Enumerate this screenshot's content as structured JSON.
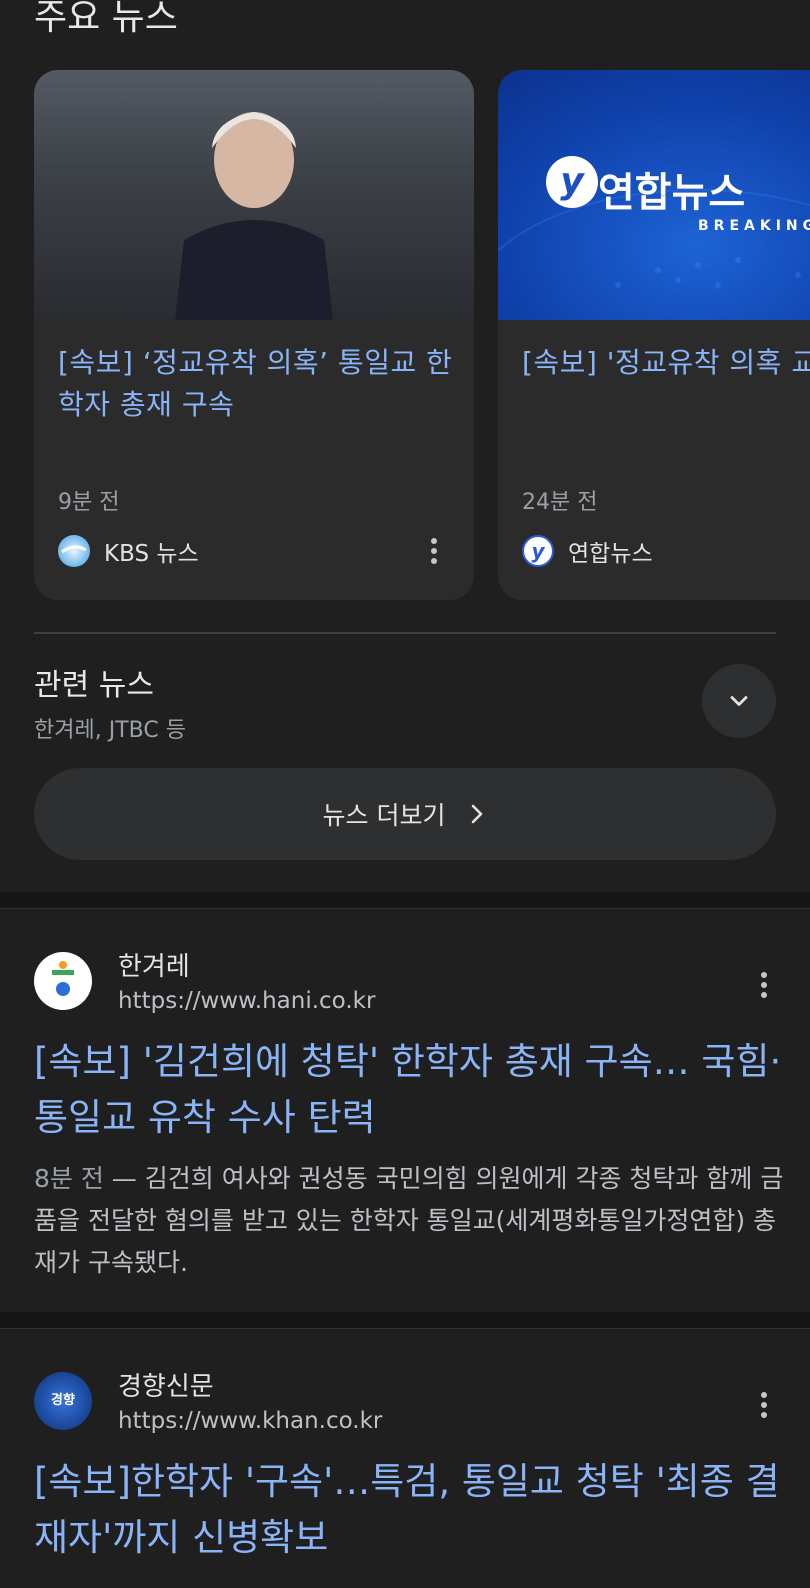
{
  "top_news": {
    "heading": "주요 뉴스",
    "cards": [
      {
        "title": "[속보] ‘정교유착 의혹’ 통일교 한학자 총재 구속",
        "time": "9분 전",
        "source": "KBS 뉴스"
      },
      {
        "title": "[속보] '정교유착 의혹 교 한학자 총재 구속",
        "time": "24분 전",
        "source": "연합뉴스",
        "image_logo_text": "연합뉴스",
        "image_breaking_text": "BREAKING"
      }
    ]
  },
  "related": {
    "title": "관련 뉴스",
    "subtitle": "한겨레, JTBC 등"
  },
  "more_news_label": "뉴스 더보기",
  "results": [
    {
      "site_name": "한겨레",
      "url": "https://www.hani.co.kr",
      "title": "[속보] '김건희에 청탁' 한학자 총재 구속… 국힘·통일교 유착 수사 탄력",
      "time": "8분 전",
      "snippet": " — 김건희 여사와 권성동 국민의힘 의원에게 각종 청탁과 함께 금품을 전달한 혐의를 받고 있는 한학자 통일교(세계평화통일가정연합) 총재가 구속됐다."
    },
    {
      "site_name": "경향신문",
      "url": "https://www.khan.co.kr",
      "logo_text": "경향",
      "title": "[속보]한학자 '구속'…특검, 통일교 청탁 '최종 결재자'까지 신병확보"
    }
  ],
  "colors": {
    "background": "#1f1f1f",
    "card": "#2b2b2c",
    "link": "#8ab4f8",
    "secondary_text": "#9aa0a6"
  },
  "icons": [
    "kbs-logo-icon",
    "yonhap-logo-icon",
    "more-vert-icon",
    "chevron-down-icon",
    "chevron-right-icon",
    "hani-logo-icon",
    "khan-logo-icon"
  ]
}
